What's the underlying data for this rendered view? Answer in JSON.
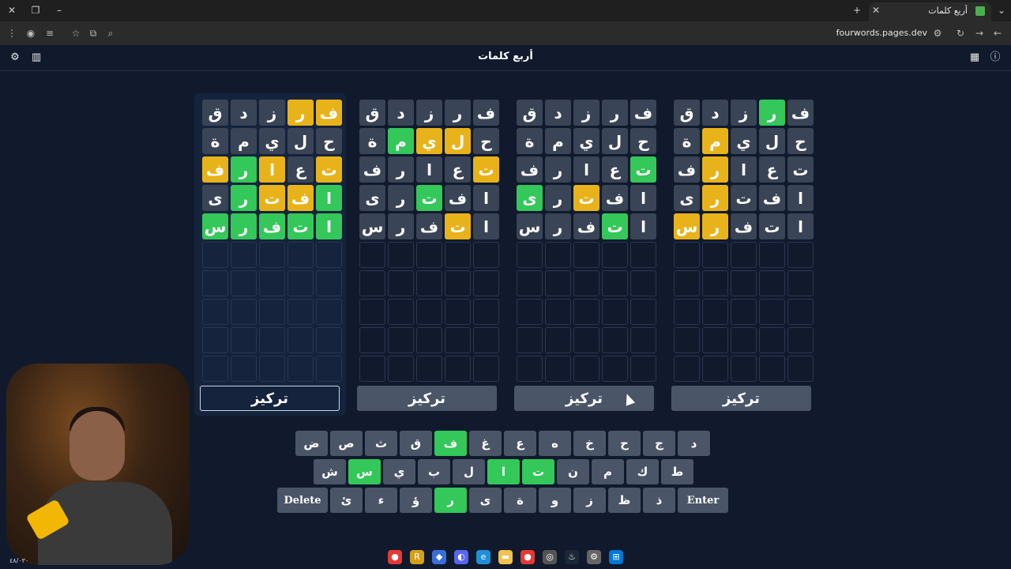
{
  "browser": {
    "tab_title": "أربع كلمات",
    "url": "fourwords.pages.dev"
  },
  "app": {
    "title": "أربع كلمات"
  },
  "focus_label": "تركيز",
  "boards": [
    {
      "rows": [
        [
          [
            "ف",
            "y"
          ],
          [
            "ر",
            "y"
          ],
          [
            "ز",
            ""
          ],
          [
            "د",
            ""
          ],
          [
            "ق",
            ""
          ]
        ],
        [
          [
            "ح",
            ""
          ],
          [
            "ل",
            ""
          ],
          [
            "ي",
            ""
          ],
          [
            "م",
            ""
          ],
          [
            "ة",
            ""
          ]
        ],
        [
          [
            "ت",
            "y"
          ],
          [
            "ع",
            ""
          ],
          [
            "ا",
            "y"
          ],
          [
            "ر",
            "g"
          ],
          [
            "ف",
            "y"
          ]
        ],
        [
          [
            "ا",
            "g"
          ],
          [
            "ف",
            "y"
          ],
          [
            "ت",
            "y"
          ],
          [
            "ر",
            "g"
          ],
          [
            "ى",
            ""
          ]
        ],
        [
          [
            "ا",
            "g"
          ],
          [
            "ت",
            "g"
          ],
          [
            "ف",
            "g"
          ],
          [
            "ر",
            "g"
          ],
          [
            "س",
            "g"
          ]
        ]
      ]
    },
    {
      "rows": [
        [
          [
            "ف",
            ""
          ],
          [
            "ر",
            ""
          ],
          [
            "ز",
            ""
          ],
          [
            "د",
            ""
          ],
          [
            "ق",
            ""
          ]
        ],
        [
          [
            "ح",
            ""
          ],
          [
            "ل",
            "y"
          ],
          [
            "ي",
            "y"
          ],
          [
            "م",
            "g"
          ],
          [
            "ة",
            ""
          ]
        ],
        [
          [
            "ت",
            "y"
          ],
          [
            "ع",
            ""
          ],
          [
            "ا",
            ""
          ],
          [
            "ر",
            ""
          ],
          [
            "ف",
            ""
          ]
        ],
        [
          [
            "ا",
            ""
          ],
          [
            "ف",
            ""
          ],
          [
            "ت",
            "g"
          ],
          [
            "ر",
            ""
          ],
          [
            "ى",
            ""
          ]
        ],
        [
          [
            "ا",
            ""
          ],
          [
            "ت",
            "y"
          ],
          [
            "ف",
            ""
          ],
          [
            "ر",
            ""
          ],
          [
            "س",
            ""
          ]
        ]
      ]
    },
    {
      "rows": [
        [
          [
            "ف",
            ""
          ],
          [
            "ر",
            ""
          ],
          [
            "ز",
            ""
          ],
          [
            "د",
            ""
          ],
          [
            "ق",
            ""
          ]
        ],
        [
          [
            "ح",
            ""
          ],
          [
            "ل",
            ""
          ],
          [
            "ي",
            ""
          ],
          [
            "م",
            ""
          ],
          [
            "ة",
            ""
          ]
        ],
        [
          [
            "ت",
            "g"
          ],
          [
            "ع",
            ""
          ],
          [
            "ا",
            ""
          ],
          [
            "ر",
            ""
          ],
          [
            "ف",
            ""
          ]
        ],
        [
          [
            "ا",
            ""
          ],
          [
            "ف",
            ""
          ],
          [
            "ت",
            "y"
          ],
          [
            "ر",
            ""
          ],
          [
            "ى",
            "g"
          ]
        ],
        [
          [
            "ا",
            ""
          ],
          [
            "ت",
            "g"
          ],
          [
            "ف",
            ""
          ],
          [
            "ر",
            ""
          ],
          [
            "س",
            ""
          ]
        ]
      ]
    },
    {
      "rows": [
        [
          [
            "ف",
            ""
          ],
          [
            "ر",
            "g"
          ],
          [
            "ز",
            ""
          ],
          [
            "د",
            ""
          ],
          [
            "ق",
            ""
          ]
        ],
        [
          [
            "ح",
            ""
          ],
          [
            "ل",
            ""
          ],
          [
            "ي",
            ""
          ],
          [
            "م",
            "y"
          ],
          [
            "ة",
            ""
          ]
        ],
        [
          [
            "ت",
            ""
          ],
          [
            "ع",
            ""
          ],
          [
            "ا",
            ""
          ],
          [
            "ر",
            "y"
          ],
          [
            "ف",
            ""
          ]
        ],
        [
          [
            "ا",
            ""
          ],
          [
            "ف",
            ""
          ],
          [
            "ت",
            ""
          ],
          [
            "ر",
            "y"
          ],
          [
            "ى",
            ""
          ]
        ],
        [
          [
            "ا",
            ""
          ],
          [
            "ت",
            ""
          ],
          [
            "ف",
            ""
          ],
          [
            "ر",
            "y"
          ],
          [
            "س",
            "y"
          ]
        ]
      ]
    }
  ],
  "keyboard": {
    "row1": [
      [
        "د",
        ""
      ],
      [
        "ج",
        ""
      ],
      [
        "ح",
        ""
      ],
      [
        "خ",
        ""
      ],
      [
        "ه",
        ""
      ],
      [
        "ع",
        ""
      ],
      [
        "غ",
        ""
      ],
      [
        "ف",
        "g"
      ],
      [
        "ق",
        ""
      ],
      [
        "ث",
        ""
      ],
      [
        "ص",
        ""
      ],
      [
        "ض",
        ""
      ]
    ],
    "row2": [
      [
        "ط",
        ""
      ],
      [
        "ك",
        ""
      ],
      [
        "م",
        ""
      ],
      [
        "ن",
        ""
      ],
      [
        "ت",
        "g"
      ],
      [
        "ا",
        "g"
      ],
      [
        "ل",
        ""
      ],
      [
        "ب",
        ""
      ],
      [
        "ي",
        ""
      ],
      [
        "س",
        "g"
      ],
      [
        "ش",
        ""
      ]
    ],
    "row3_enter": "Enter",
    "row3": [
      [
        "ذ",
        ""
      ],
      [
        "ظ",
        ""
      ],
      [
        "ز",
        ""
      ],
      [
        "و",
        ""
      ],
      [
        "ة",
        ""
      ],
      [
        "ى",
        ""
      ],
      [
        "ر",
        "g"
      ],
      [
        "ؤ",
        ""
      ],
      [
        "ء",
        ""
      ],
      [
        "ئ",
        ""
      ]
    ],
    "row3_delete": "Delete"
  },
  "clock": "٤٨/٠٣٠"
}
